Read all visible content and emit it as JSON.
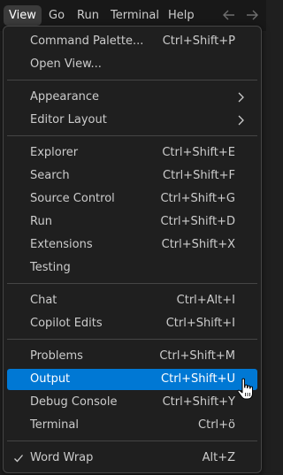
{
  "menubar": {
    "items": [
      {
        "label": "View",
        "active": true
      },
      {
        "label": "Go"
      },
      {
        "label": "Run"
      },
      {
        "label": "Terminal"
      },
      {
        "label": "Help"
      }
    ],
    "back_icon": "arrow-left-icon",
    "forward_icon": "arrow-right-icon"
  },
  "menu": {
    "items": [
      {
        "label": "Command Palette...",
        "shortcut": "Ctrl+Shift+P"
      },
      {
        "label": "Open View..."
      },
      {
        "label": "Appearance",
        "submenu": true
      },
      {
        "label": "Editor Layout",
        "submenu": true
      },
      {
        "label": "Explorer",
        "shortcut": "Ctrl+Shift+E"
      },
      {
        "label": "Search",
        "shortcut": "Ctrl+Shift+F"
      },
      {
        "label": "Source Control",
        "shortcut": "Ctrl+Shift+G"
      },
      {
        "label": "Run",
        "shortcut": "Ctrl+Shift+D"
      },
      {
        "label": "Extensions",
        "shortcut": "Ctrl+Shift+X"
      },
      {
        "label": "Testing"
      },
      {
        "label": "Chat",
        "shortcut": "Ctrl+Alt+I"
      },
      {
        "label": "Copilot Edits",
        "shortcut": "Ctrl+Shift+I"
      },
      {
        "label": "Problems",
        "shortcut": "Ctrl+Shift+M"
      },
      {
        "label": "Output",
        "shortcut": "Ctrl+Shift+U",
        "selected": true
      },
      {
        "label": "Debug Console",
        "shortcut": "Ctrl+Shift+Y"
      },
      {
        "label": "Terminal",
        "shortcut": "Ctrl+ö"
      },
      {
        "label": "Word Wrap",
        "shortcut": "Alt+Z",
        "checked": true
      }
    ]
  },
  "colors": {
    "menubar_bg": "#181818",
    "menu_bg": "#1f1f1f",
    "menu_border": "#454545",
    "selection": "#0078d4",
    "text": "#cccccc"
  }
}
